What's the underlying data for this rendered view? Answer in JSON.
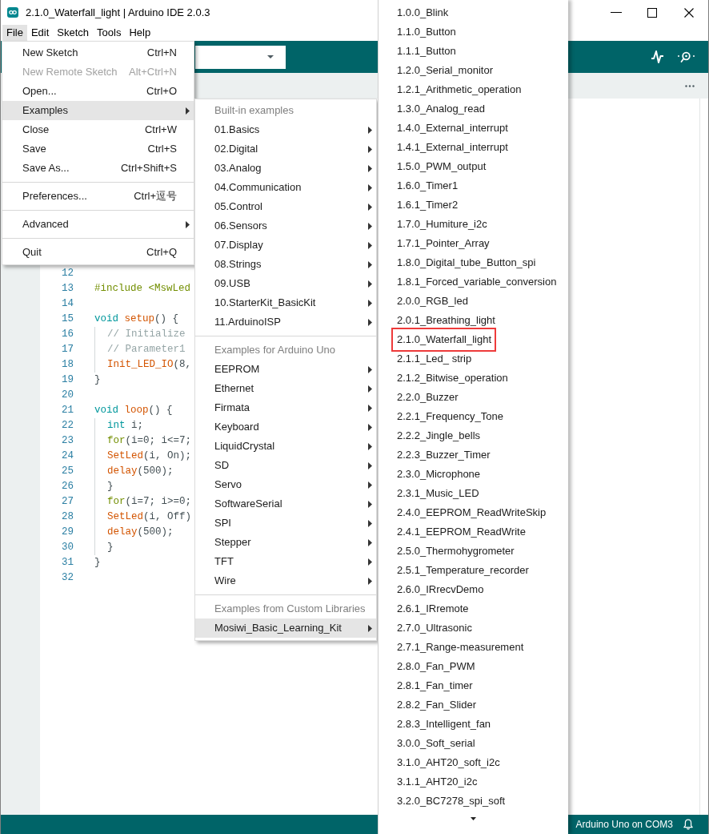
{
  "window": {
    "title": "2.1.0_Waterfall_light | Arduino IDE 2.0.3"
  },
  "menubar": [
    {
      "label": "File",
      "selected": true
    },
    {
      "label": "Edit",
      "selected": false
    },
    {
      "label": "Sketch",
      "selected": false
    },
    {
      "label": "Tools",
      "selected": false
    },
    {
      "label": "Help",
      "selected": false
    }
  ],
  "file_menu": {
    "groups": [
      {
        "items": [
          {
            "kind": "item",
            "label": "New Sketch",
            "shortcut": "Ctrl+N",
            "selected": false,
            "disabled": false
          },
          {
            "kind": "item",
            "label": "New Remote Sketch",
            "shortcut": "Alt+Ctrl+N",
            "selected": false,
            "disabled": true
          },
          {
            "kind": "item",
            "label": "Open...",
            "shortcut": "Ctrl+O",
            "selected": false,
            "disabled": false
          },
          {
            "kind": "submenu",
            "label": "Examples",
            "selected": true,
            "disabled": false
          },
          {
            "kind": "item",
            "label": "Close",
            "shortcut": "Ctrl+W",
            "selected": false,
            "disabled": false
          },
          {
            "kind": "item",
            "label": "Save",
            "shortcut": "Ctrl+S",
            "selected": false,
            "disabled": false
          },
          {
            "kind": "item",
            "label": "Save As...",
            "shortcut": "Ctrl+Shift+S",
            "selected": false,
            "disabled": false
          }
        ]
      },
      {
        "items": [
          {
            "kind": "item",
            "label": "Preferences...",
            "shortcut": "Ctrl+逗号",
            "selected": false,
            "disabled": false
          }
        ]
      },
      {
        "items": [
          {
            "kind": "submenu",
            "label": "Advanced",
            "selected": false,
            "disabled": false
          }
        ]
      },
      {
        "items": [
          {
            "kind": "item",
            "label": "Quit",
            "shortcut": "Ctrl+Q",
            "selected": false,
            "disabled": false
          }
        ]
      }
    ]
  },
  "examples_menu": {
    "sections": [
      {
        "header": "Built-in examples",
        "items": [
          {
            "label": "01.Basics",
            "selected": false
          },
          {
            "label": "02.Digital",
            "selected": false
          },
          {
            "label": "03.Analog",
            "selected": false
          },
          {
            "label": "04.Communication",
            "selected": false
          },
          {
            "label": "05.Control",
            "selected": false
          },
          {
            "label": "06.Sensors",
            "selected": false
          },
          {
            "label": "07.Display",
            "selected": false
          },
          {
            "label": "08.Strings",
            "selected": false
          },
          {
            "label": "09.USB",
            "selected": false
          },
          {
            "label": "10.StarterKit_BasicKit",
            "selected": false
          },
          {
            "label": "11.ArduinoISP",
            "selected": false
          }
        ]
      },
      {
        "header": "Examples for Arduino Uno",
        "items": [
          {
            "label": "EEPROM",
            "selected": false
          },
          {
            "label": "Ethernet",
            "selected": false
          },
          {
            "label": "Firmata",
            "selected": false
          },
          {
            "label": "Keyboard",
            "selected": false
          },
          {
            "label": "LiquidCrystal",
            "selected": false
          },
          {
            "label": "SD",
            "selected": false
          },
          {
            "label": "Servo",
            "selected": false
          },
          {
            "label": "SoftwareSerial",
            "selected": false
          },
          {
            "label": "SPI",
            "selected": false
          },
          {
            "label": "Stepper",
            "selected": false
          },
          {
            "label": "TFT",
            "selected": false
          },
          {
            "label": "Wire",
            "selected": false
          }
        ]
      },
      {
        "header": "Examples from Custom Libraries",
        "items": [
          {
            "label": "Mosiwi_Basic_Learning_Kit",
            "selected": true
          }
        ]
      }
    ]
  },
  "library_examples_menu": {
    "items": [
      {
        "label": "1.0.0_Blink",
        "selected": false,
        "annotated": false
      },
      {
        "label": "1.1.0_Button",
        "selected": false,
        "annotated": false
      },
      {
        "label": "1.1.1_Button",
        "selected": false,
        "annotated": false
      },
      {
        "label": "1.2.0_Serial_monitor",
        "selected": false,
        "annotated": false
      },
      {
        "label": "1.2.1_Arithmetic_operation",
        "selected": false,
        "annotated": false
      },
      {
        "label": "1.3.0_Analog_read",
        "selected": false,
        "annotated": false
      },
      {
        "label": "1.4.0_External_interrupt",
        "selected": false,
        "annotated": false
      },
      {
        "label": "1.4.1_External_interrupt",
        "selected": false,
        "annotated": false
      },
      {
        "label": "1.5.0_PWM_output",
        "selected": false,
        "annotated": false
      },
      {
        "label": "1.6.0_Timer1",
        "selected": false,
        "annotated": false
      },
      {
        "label": "1.6.1_Timer2",
        "selected": false,
        "annotated": false
      },
      {
        "label": "1.7.0_Humiture_i2c",
        "selected": false,
        "annotated": false
      },
      {
        "label": "1.7.1_Pointer_Array",
        "selected": false,
        "annotated": false
      },
      {
        "label": "1.8.0_Digital_tube_Button_spi",
        "selected": false,
        "annotated": false
      },
      {
        "label": "1.8.1_Forced_variable_conversion",
        "selected": false,
        "annotated": false
      },
      {
        "label": "2.0.0_RGB_led",
        "selected": false,
        "annotated": false
      },
      {
        "label": "2.0.1_Breathing_light",
        "selected": false,
        "annotated": false
      },
      {
        "label": "2.1.0_Waterfall_light",
        "selected": false,
        "annotated": true
      },
      {
        "label": "2.1.1_Led_ strip",
        "selected": false,
        "annotated": false
      },
      {
        "label": "2.1.2_Bitwise_operation",
        "selected": false,
        "annotated": false
      },
      {
        "label": "2.2.0_Buzzer",
        "selected": false,
        "annotated": false
      },
      {
        "label": "2.2.1_Frequency_Tone",
        "selected": false,
        "annotated": false
      },
      {
        "label": "2.2.2_Jingle_bells",
        "selected": false,
        "annotated": false
      },
      {
        "label": "2.2.3_Buzzer_Timer",
        "selected": false,
        "annotated": false
      },
      {
        "label": "2.3.0_Microphone",
        "selected": false,
        "annotated": false
      },
      {
        "label": "2.3.1_Music_LED",
        "selected": false,
        "annotated": false
      },
      {
        "label": "2.4.0_EEPROM_ReadWriteSkip",
        "selected": false,
        "annotated": false
      },
      {
        "label": "2.4.1_EEPROM_ReadWrite",
        "selected": false,
        "annotated": false
      },
      {
        "label": "2.5.0_Thermohygrometer",
        "selected": false,
        "annotated": false
      },
      {
        "label": "2.5.1_Temperature_recorder",
        "selected": false,
        "annotated": false
      },
      {
        "label": "2.6.0_IRrecvDemo",
        "selected": false,
        "annotated": false
      },
      {
        "label": "2.6.1_IRremote",
        "selected": false,
        "annotated": false
      },
      {
        "label": "2.7.0_Ultrasonic",
        "selected": false,
        "annotated": false
      },
      {
        "label": "2.7.1_Range-measurement",
        "selected": false,
        "annotated": false
      },
      {
        "label": "2.8.0_Fan_PWM",
        "selected": false,
        "annotated": false
      },
      {
        "label": "2.8.1_Fan_timer",
        "selected": false,
        "annotated": false
      },
      {
        "label": "2.8.2_Fan_Slider",
        "selected": false,
        "annotated": false
      },
      {
        "label": "2.8.3_Intelligent_fan",
        "selected": false,
        "annotated": false
      },
      {
        "label": "3.0.0_Soft_serial",
        "selected": false,
        "annotated": false
      },
      {
        "label": "3.1.0_AHT20_soft_i2c",
        "selected": false,
        "annotated": false
      },
      {
        "label": "3.1.1_AHT20_i2c",
        "selected": false,
        "annotated": false
      },
      {
        "label": "3.2.0_BC7278_spi_soft",
        "selected": false,
        "annotated": false
      }
    ]
  },
  "editor": {
    "lines": [
      {
        "number": "12"
      },
      {
        "number": "13",
        "indented": false,
        "tokens": [
          {
            "kind": "directive",
            "text": "#include <MswLed"
          }
        ]
      },
      {
        "number": "14"
      },
      {
        "number": "15",
        "indented": false,
        "tokens": [
          {
            "kind": "type",
            "text": "void "
          },
          {
            "kind": "function",
            "text": "setup"
          },
          {
            "kind": "plain",
            "text": "() {"
          }
        ]
      },
      {
        "number": "16",
        "indented": true,
        "tokens": [
          {
            "kind": "comment",
            "text": "// Initialize"
          }
        ]
      },
      {
        "number": "17",
        "indented": true,
        "tokens": [
          {
            "kind": "comment",
            "text": "// Parameter1"
          }
        ]
      },
      {
        "number": "18",
        "indented": true,
        "tokens": [
          {
            "kind": "function",
            "text": "Init_LED_IO"
          },
          {
            "kind": "plain",
            "text": "(8,"
          }
        ]
      },
      {
        "number": "19",
        "indented": false,
        "tokens": [
          {
            "kind": "plain",
            "text": "}"
          }
        ]
      },
      {
        "number": "20"
      },
      {
        "number": "21",
        "indented": false,
        "tokens": [
          {
            "kind": "type",
            "text": "void "
          },
          {
            "kind": "function",
            "text": "loop"
          },
          {
            "kind": "plain",
            "text": "() {"
          }
        ]
      },
      {
        "number": "22",
        "indented": true,
        "tokens": [
          {
            "kind": "type",
            "text": "int"
          },
          {
            "kind": "plain",
            "text": " i;"
          }
        ]
      },
      {
        "number": "23",
        "indented": true,
        "tokens": [
          {
            "kind": "control",
            "text": "for"
          },
          {
            "kind": "plain",
            "text": "(i=0; i<=7;"
          }
        ]
      },
      {
        "number": "24",
        "indented": true,
        "tokens": [
          {
            "kind": "function",
            "text": "SetLed"
          },
          {
            "kind": "plain",
            "text": "(i, On);"
          }
        ]
      },
      {
        "number": "25",
        "indented": true,
        "tokens": [
          {
            "kind": "function",
            "text": "delay"
          },
          {
            "kind": "plain",
            "text": "(500);"
          }
        ]
      },
      {
        "number": "26",
        "indented": true,
        "tokens": [
          {
            "kind": "plain",
            "text": "}"
          }
        ]
      },
      {
        "number": "27",
        "indented": true,
        "tokens": [
          {
            "kind": "control",
            "text": "for"
          },
          {
            "kind": "plain",
            "text": "(i=7; i>=0;"
          }
        ]
      },
      {
        "number": "28",
        "indented": true,
        "tokens": [
          {
            "kind": "function",
            "text": "SetLed"
          },
          {
            "kind": "plain",
            "text": "(i, Off)"
          }
        ]
      },
      {
        "number": "29",
        "indented": true,
        "tokens": [
          {
            "kind": "function",
            "text": "delay"
          },
          {
            "kind": "plain",
            "text": "(500);"
          }
        ]
      },
      {
        "number": "30",
        "indented": true,
        "tokens": [
          {
            "kind": "plain",
            "text": "}"
          }
        ]
      },
      {
        "number": "31",
        "indented": false,
        "tokens": [
          {
            "kind": "plain",
            "text": "}"
          }
        ]
      },
      {
        "number": "32"
      }
    ]
  },
  "status_bar": {
    "board": "Arduino Uno on COM3"
  }
}
